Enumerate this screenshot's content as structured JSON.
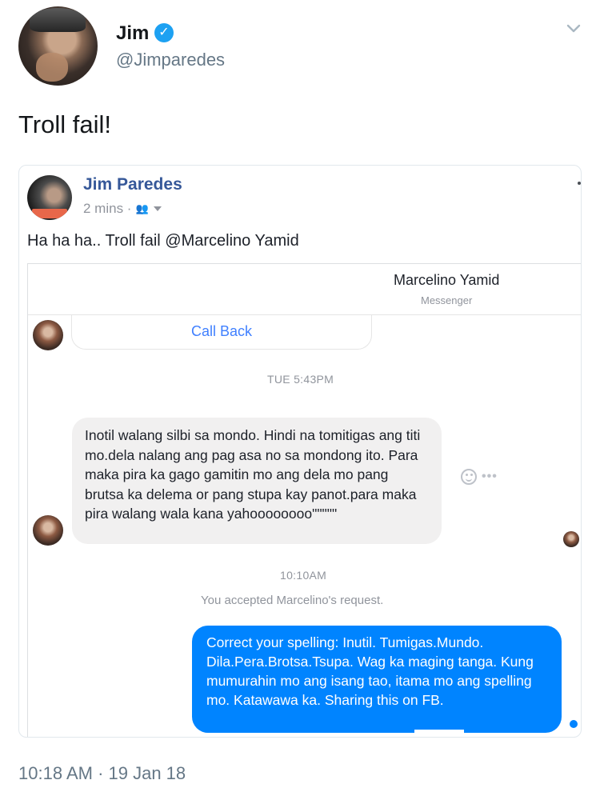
{
  "tweet": {
    "author_name": "Jim",
    "author_handle": "@Jimparedes",
    "text": "Troll fail!",
    "timestamp": "10:18 AM · 19 Jan 18",
    "verified_icon": "verified-badge-icon",
    "menu_icon": "chevron-down-icon"
  },
  "embedded_post": {
    "poster_name": "Jim Paredes",
    "post_age": "2 mins ·",
    "audience_icon": "friends-icon",
    "post_text": "Ha ha ha.. Troll fail @Marcelino Yamid",
    "messenger": {
      "contact_name": "Marcelino Yamid",
      "contact_sub": "Messenger",
      "call_back_label": "Call Back",
      "timestamp_1": "TUE 5:43PM",
      "incoming_message": "Inotil walang silbi sa mondo. Hindi na tomitigas ang titi mo.dela nalang ang pag asa no sa mondong ito. Para maka pira ka gago gamitin mo ang dela mo pang brutsa ka delema or pang stupa kay panot.para maka pira walang wala kana yahoooooooo\"\"\"\"\"",
      "timestamp_2": "10:10AM",
      "system_message": "You accepted Marcelino's request.",
      "outgoing_message": "Correct your  spelling: Inutil. Tumigas.Mundo. Dila.Pera.Brotsa.Tsupa. Wag ka maging tanga. Kung mumurahin mo ang isang tao, itama mo ang spelling mo. Katawawa  ka. Sharing this on FB.",
      "more_label": "•••"
    }
  },
  "colors": {
    "twitter_blue": "#1da1f2",
    "fb_link": "#365899",
    "messenger_blue": "#0084ff",
    "incoming_bubble": "#f1f0f0"
  }
}
